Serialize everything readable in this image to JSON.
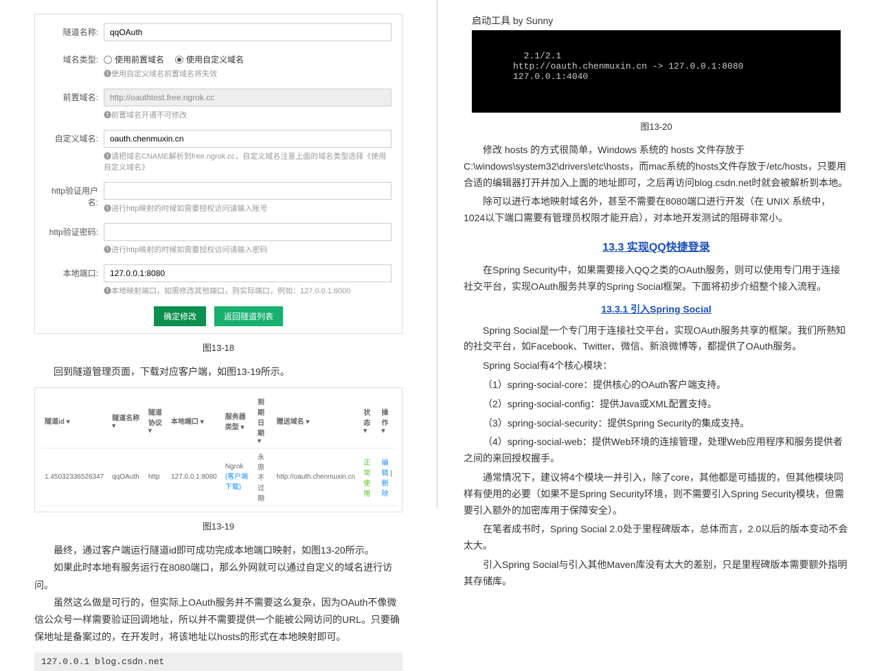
{
  "left": {
    "form": {
      "tunnel_name": {
        "label": "隧道名称:",
        "value": "qqOAuth"
      },
      "domain_type": {
        "label": "域名类型:",
        "opt1": "使用前置域名",
        "opt2": "使用自定义域名",
        "hint": "❶使用自定义域名前置域名将失效"
      },
      "prefix": {
        "label": "前置域名:",
        "value": "http://oauthtest.free.ngrok.cc",
        "hint": "❶前置域名开通不可修改"
      },
      "custom": {
        "label": "自定义域名:",
        "value": "oauth.chenmuxin.cn",
        "hint": "❶请把域名CNAME解析到free.ngrok.cc，自定义域名注意上面的域名类型选择《使用自定义域名》"
      },
      "http_user": {
        "label": "http验证用户名:",
        "value": "",
        "hint": "❶进行http映射的时候如需要授权访问请输入账号"
      },
      "http_pass": {
        "label": "http验证密码:",
        "value": "",
        "hint": "❶进行http映射的时候如需要授权访问请输入密码"
      },
      "local_port": {
        "label": "本地端口:",
        "value": "127.0.0.1:8080",
        "hint": "❶本地映射端口，如需修改其他端口，则实际端口，例如：127.0.0.1:8000"
      },
      "btn_save": "确定修改",
      "btn_back": "返回隧道列表"
    },
    "cap18": "图13-18",
    "p1": "回到隧道管理页面，下载对应客户端，如图13-19所示。",
    "table": {
      "headers": [
        "隧道id ▾",
        "隧道名称 ▾",
        "隧道协议 ▾",
        "本地端口 ▾",
        "服务器类型 ▾",
        "到期日期 ▾",
        "赠送域名 ▾",
        "状态 ▾",
        "操作 ▾"
      ],
      "row": {
        "id": "1.45032336526347",
        "name": "qqOAuth",
        "proto": "http",
        "port": "127.0.0.1:8080",
        "server": "Ngrok",
        "server_link": "(客户端下载)",
        "expire": "永原不过期",
        "domain": "http://oauth.chenmuxin.cn",
        "status": "正常使用",
        "op1": "编辑",
        "op2": "删除"
      }
    },
    "cap19": "图13-19",
    "p2": "最终，通过客户端运行隧道id即可成功完成本地端口映射，如图13-20所示。",
    "p3": "如果此时本地有服务运行在8080端口，那么外网就可以通过自定义的域名进行访问。",
    "p4": "虽然这么做是可行的，但实际上OAuth服务并不需要这么复杂，因为OAuth不像微信公众号一样需要验证回调地址，所以并不需要提供一个能被公网访问的URL。只要确保地址是备案过的，在开发时，将该地址以hosts的形式在本地映射即可。",
    "code": "127.0.0.1 blog.csdn.net"
  },
  "right": {
    "term_title": "启动工具 by Sunny",
    "term_l1": "  2.1/2.1",
    "term_l2": "http://oauth.chenmuxin.cn -> 127.0.0.1:8080",
    "term_l3": "127.0.0.1:4040",
    "cap20": "图13-20",
    "p1": "修改         hosts         的方式很简单，Windows         系统的         hosts         文件存放于C:\\windows\\system32\\drivers\\etc\\hosts，而mac系统的hosts文件存放于/etc/hosts，只要用合适的编辑器打开并加入上面的地址即可，之后再访问blog.csdn.net时就会被解析到本地。",
    "p2": "除可以进行本地映射域名外，甚至不需要在8080端口进行开发（在 UNIX 系统中，1024以下端口需要有管理员权限才能开启），对本地开发测试的阻碍非常小。",
    "sec": "13.3 实现QQ快捷登录",
    "p3": "在Spring Security中，如果需要接入QQ之类的OAuth服务，则可以使用专门用于连接社交平台，实现OAuth服务共享的Spring Social框架。下面将初步介绍整个接入流程。",
    "sub": "13.3.1 引入Spring Social",
    "p4": "Spring     Social是一个专门用于连接社交平台，实现OAuth服务共享的框架。我们所熟知的社交平台，如Facebook、Twitter、微信、新浪微博等，都提供了OAuth服务。",
    "p5": "Spring Social有4个核心模块：",
    "p6": "（1）spring-social-core：提供核心的OAuth客户端支持。",
    "p7": "（2）spring-social-config：提供Java或XML配置支持。",
    "p8": "（3）spring-social-security：提供Spring Security的集成支持。",
    "p9": "（4）spring-social-web：提供Web环境的连接管理，处理Web应用程序和服务提供者之间的来回授权握手。",
    "p10": "通常情况下，建议将4个模块一并引入，除了core，其他都是可插拔的，但其他模块同样有使用的必要（如果不是Spring Security环境，则不需要引入Spring Security模块，但需要引入额外的加密库用于保障安全）。",
    "p11": "在笔者成书时，Spring Social 2.0处于里程碑版本，总体而言，2.0以后的版本变动不会太大。",
    "p12": "引入Spring Social与引入其他Maven库没有太大的差别，只是里程碑版本需要额外指明其存储库。"
  }
}
